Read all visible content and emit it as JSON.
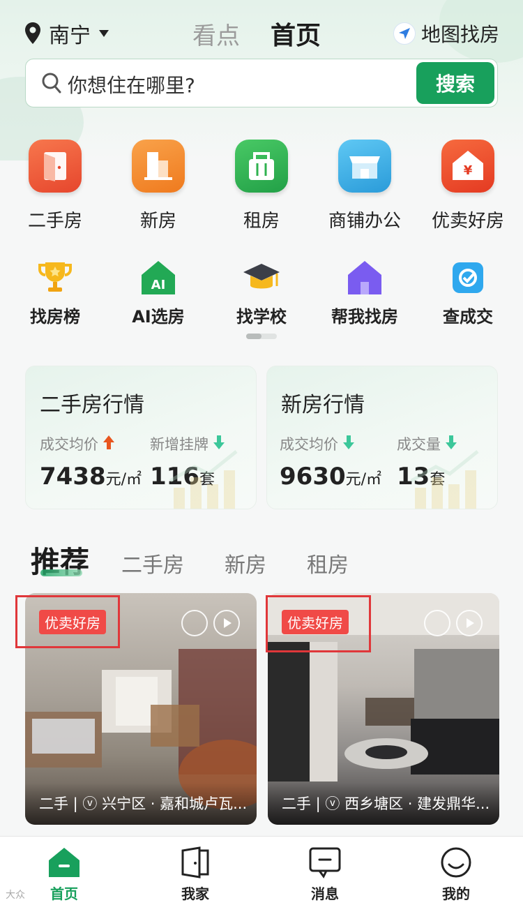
{
  "header": {
    "city": "南宁",
    "tabs": [
      "看点",
      "首页"
    ],
    "map_find": "地图找房"
  },
  "search": {
    "placeholder": "你想住在哪里?",
    "button": "搜索"
  },
  "main_entries": [
    {
      "label": "二手房",
      "icon": "door-icon",
      "color": "#ef5a3c"
    },
    {
      "label": "新房",
      "icon": "building-icon",
      "color": "#f5882a"
    },
    {
      "label": "租房",
      "icon": "bag-icon",
      "color": "#2fb24f"
    },
    {
      "label": "商铺办公",
      "icon": "shop-icon",
      "color": "#3aaee8"
    },
    {
      "label": "优卖好房",
      "icon": "yen-house-icon",
      "color": "#ef4a2c"
    }
  ],
  "sub_entries": [
    {
      "label": "找房榜",
      "icon": "trophy-icon"
    },
    {
      "label": "AI选房",
      "icon": "ai-house-icon"
    },
    {
      "label": "找学校",
      "icon": "graduation-cap-icon"
    },
    {
      "label": "帮我找房",
      "icon": "purple-house-icon"
    },
    {
      "label": "查成交",
      "icon": "check-doc-icon"
    }
  ],
  "market": [
    {
      "title": "二手房行情",
      "k1": "成交均价",
      "k1_trend": "up",
      "v1": "7438",
      "v1_unit": "元/㎡",
      "k2": "新增挂牌",
      "k2_trend": "down",
      "v2": "116",
      "v2_unit": "套"
    },
    {
      "title": "新房行情",
      "k1": "成交均价",
      "k1_trend": "down",
      "v1": "9630",
      "v1_unit": "元/㎡",
      "k2": "成交量",
      "k2_trend": "down",
      "v2": "13",
      "v2_unit": "套"
    }
  ],
  "recommend_tabs": [
    "推荐",
    "二手房",
    "新房",
    "租房"
  ],
  "listings": [
    {
      "badge": "优卖好房",
      "caption": "二手 | ⓥ 兴宁区 · 嘉和城卢瓦..."
    },
    {
      "badge": "优卖好房",
      "caption": "二手 | ⓥ 西乡塘区 · 建发鼎华..."
    }
  ],
  "bottom_nav": [
    "首页",
    "我家",
    "消息",
    "我的"
  ],
  "watermark": "大众"
}
